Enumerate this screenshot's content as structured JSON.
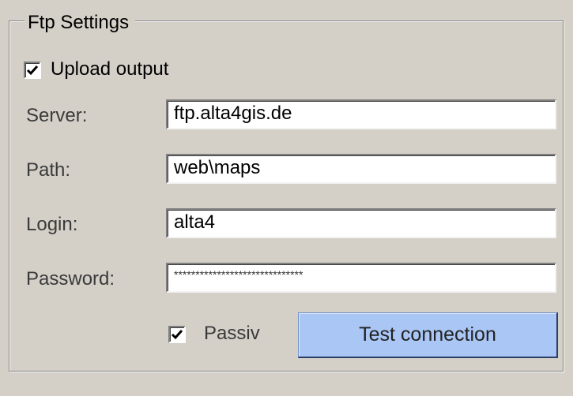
{
  "group": {
    "title": "Ftp Settings"
  },
  "upload": {
    "label": "Upload output",
    "checked": true
  },
  "fields": {
    "server": {
      "label": "Server:",
      "value": "ftp.alta4gis.de"
    },
    "path": {
      "label": "Path:",
      "value": "web\\maps"
    },
    "login": {
      "label": "Login:",
      "value": "alta4"
    },
    "password": {
      "label": "Password:",
      "value": "******************************"
    }
  },
  "passiv": {
    "label": "Passiv",
    "checked": true
  },
  "test_button": {
    "label": "Test connection"
  }
}
